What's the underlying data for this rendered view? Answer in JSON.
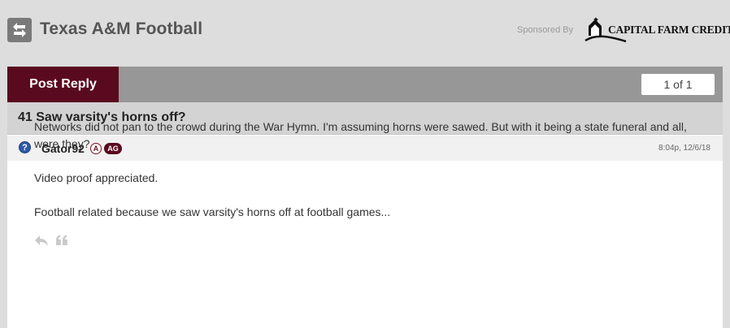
{
  "header": {
    "forum_title": "Texas A&M Football",
    "sponsored_label": "Sponsored By",
    "sponsor_name": "CAPITAL FARM CREDIT"
  },
  "toolbar": {
    "post_reply_label": "Post Reply",
    "pager_label": "1 of 1"
  },
  "thread": {
    "title": "41 Saw varsity's horns off?"
  },
  "post": {
    "status_icon": "?",
    "username": "Gator92",
    "badge_a": "A",
    "badge_ag": "AG",
    "timestamp": "8:04p, 12/6/18",
    "paragraphs": [
      "Networks did not pan to the crowd during the War Hymn. I'm assuming horns were sawed. But with it being a state funeral and all, were they?",
      "Video proof appreciated.",
      "Football related because we saw varsity's horns off at football games..."
    ]
  },
  "icons": {
    "swap": "swap-arrows-icon",
    "reply": "reply-arrow-icon",
    "quote": "quote-icon"
  },
  "colors": {
    "maroon": "#5a0a1e",
    "toolbar_gray": "#979797",
    "page_bg": "#dddddd"
  }
}
